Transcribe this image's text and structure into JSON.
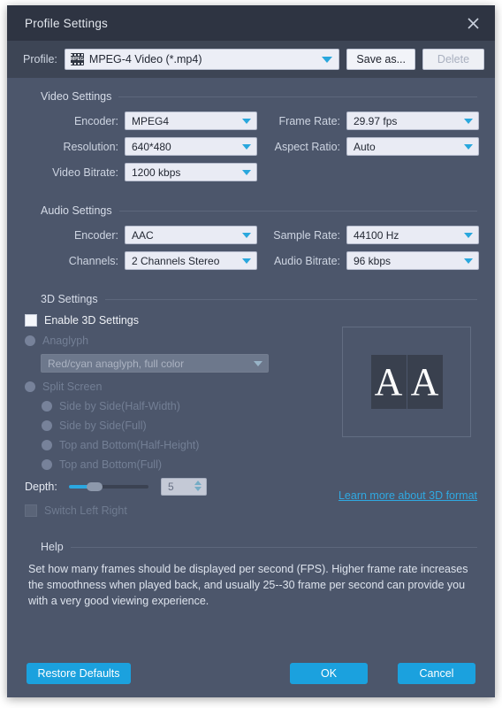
{
  "window": {
    "title": "Profile Settings",
    "close_icon": "close-icon"
  },
  "profile_bar": {
    "label": "Profile:",
    "icon": "mpeg-film-icon",
    "icon_text": "MPEG",
    "value": "MPEG-4 Video (*.mp4)",
    "save_as_label": "Save as...",
    "delete_label": "Delete"
  },
  "video_settings": {
    "title": "Video Settings",
    "encoder_label": "Encoder:",
    "encoder_value": "MPEG4",
    "frame_rate_label": "Frame Rate:",
    "frame_rate_value": "29.97 fps",
    "resolution_label": "Resolution:",
    "resolution_value": "640*480",
    "aspect_ratio_label": "Aspect Ratio:",
    "aspect_ratio_value": "Auto",
    "video_bitrate_label": "Video Bitrate:",
    "video_bitrate_value": "1200 kbps"
  },
  "audio_settings": {
    "title": "Audio Settings",
    "encoder_label": "Encoder:",
    "encoder_value": "AAC",
    "sample_rate_label": "Sample Rate:",
    "sample_rate_value": "44100 Hz",
    "channels_label": "Channels:",
    "channels_value": "2 Channels Stereo",
    "audio_bitrate_label": "Audio Bitrate:",
    "audio_bitrate_value": "96 kbps"
  },
  "threed_settings": {
    "title": "3D Settings",
    "enable_label": "Enable 3D Settings",
    "anaglyph_label": "Anaglyph",
    "anaglyph_value": "Red/cyan anaglyph, full color",
    "split_screen_label": "Split Screen",
    "options": [
      "Side by Side(Half-Width)",
      "Side by Side(Full)",
      "Top and Bottom(Half-Height)",
      "Top and Bottom(Full)"
    ],
    "depth_label": "Depth:",
    "depth_value": "5",
    "switch_left_right_label": "Switch Left Right",
    "preview_left_glyph": "A",
    "preview_right_glyph": "A",
    "learn_more_label": "Learn more about 3D format"
  },
  "help": {
    "title": "Help",
    "text": "Set how many frames should be displayed per second (FPS). Higher frame rate increases the smoothness when played back, and usually 25--30 frame per second can provide you with a very good viewing experience."
  },
  "footer": {
    "restore_label": "Restore Defaults",
    "ok_label": "OK",
    "cancel_label": "Cancel"
  },
  "colors": {
    "dialog_bg": "#4c566b",
    "titlebar_bg": "#2e3442",
    "accent": "#1ba1de",
    "link": "#2fa9e2",
    "combo_bg": "#e9ebf4"
  }
}
